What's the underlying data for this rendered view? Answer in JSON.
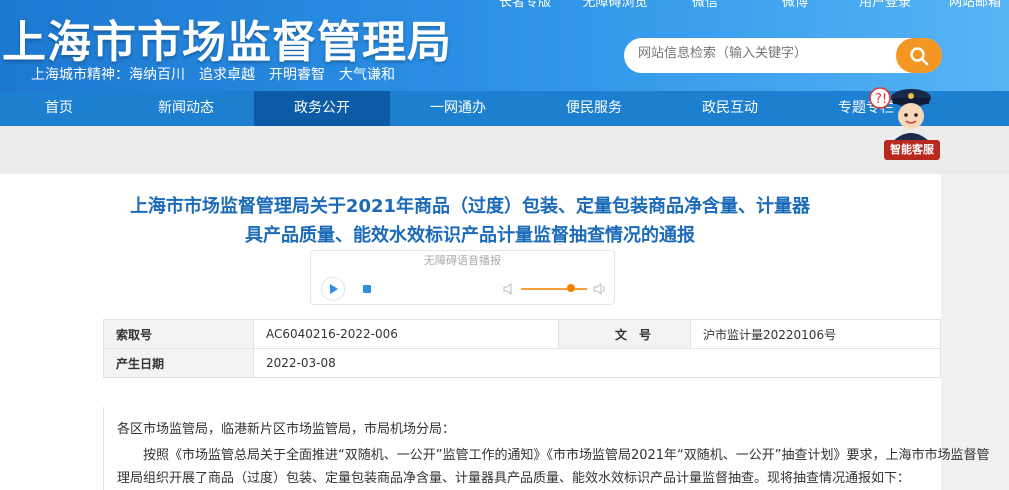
{
  "header": {
    "top_links": [
      "长者专版",
      "无障碍浏览",
      "微信",
      "微博",
      "用户登录",
      "网站邮箱"
    ],
    "site_title": "上海市市场监督管理局",
    "slogan": "上海城市精神：海纳百川　追求卓越　开明睿智　大气谦和",
    "search_placeholder": "网站信息检索（输入关键字）"
  },
  "nav": {
    "items": [
      "首页",
      "新闻动态",
      "政务公开",
      "一网通办",
      "便民服务",
      "政民互动",
      "专题专栏"
    ],
    "active_index": 2
  },
  "assistant": {
    "label": "智能客服"
  },
  "article": {
    "title_line1": "上海市市场监督管理局关于2021年商品（过度）包装、定量包装商品净含量、计量器",
    "title_line2": "具产品质量、能效水效标识产品计量监督抽查情况的通报",
    "reader_label": "无障碍语音播报",
    "meta": {
      "index_label": "索取号",
      "index_value": "AC6040216-2022-006",
      "doc_label": "文　号",
      "doc_value": "沪市监计量20220106号",
      "date_label": "产生日期",
      "date_value": "2022-03-08"
    },
    "para1": "各区市场监管局，临港新片区市场监管局，市局机场分局：",
    "para2": "按照《市场监管总局关于全面推进“双随机、一公开”监管工作的通知》《市市场监管局2021年“双随机、一公开”抽查计划》要求，上海市市场监督管理局组织开展了商品（过度）包装、定量包装商品净含量、计量器具产品质量、能效水效标识产品计量监督抽查。现将抽查情况通报如下："
  },
  "colors": {
    "header_blue": "#1d78d0",
    "nav_blue": "#1d7fcf",
    "nav_active": "#0d5ba6",
    "title_blue": "#1b6bb8",
    "search_orange": "#f39722"
  }
}
